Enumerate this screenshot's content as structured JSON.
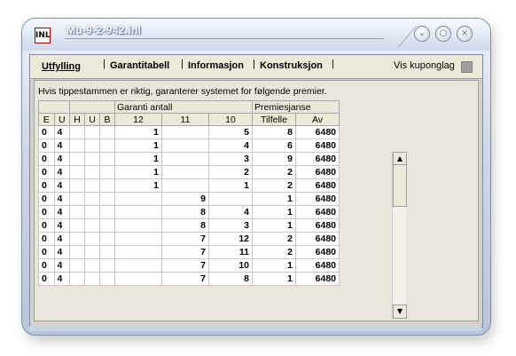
{
  "window": {
    "title": "Mu-9-2-942.inl",
    "icon_label": "INL"
  },
  "tabs": [
    {
      "label": "Utfylling",
      "active": true
    },
    {
      "label": "Garantitabell",
      "active": false
    },
    {
      "label": "Informasjon",
      "active": false
    },
    {
      "label": "Konstruksjon",
      "active": false
    }
  ],
  "separator": "|",
  "vis_kuponglag": {
    "label": "Vis kuponglag",
    "checked": false
  },
  "info_text": "Hvis tippestammen er riktig, garanterer systemet for følgende premier.",
  "table": {
    "group_headers": [
      "",
      "Garanti antall",
      "Premiesjanse"
    ],
    "columns": [
      "E",
      "U",
      "H",
      "U",
      "B",
      "12",
      "11",
      "10",
      "Tilfelle",
      "Av"
    ],
    "rows": [
      [
        "0",
        "4",
        "",
        "",
        "",
        "1",
        "",
        "5",
        "8",
        "6480"
      ],
      [
        "0",
        "4",
        "",
        "",
        "",
        "1",
        "",
        "4",
        "6",
        "6480"
      ],
      [
        "0",
        "4",
        "",
        "",
        "",
        "1",
        "",
        "3",
        "9",
        "6480"
      ],
      [
        "0",
        "4",
        "",
        "",
        "",
        "1",
        "",
        "2",
        "2",
        "6480"
      ],
      [
        "0",
        "4",
        "",
        "",
        "",
        "1",
        "",
        "1",
        "2",
        "6480"
      ],
      [
        "0",
        "4",
        "",
        "",
        "",
        "",
        "9",
        "",
        "1",
        "6480"
      ],
      [
        "0",
        "4",
        "",
        "",
        "",
        "",
        "8",
        "4",
        "1",
        "6480"
      ],
      [
        "0",
        "4",
        "",
        "",
        "",
        "",
        "8",
        "3",
        "1",
        "6480"
      ],
      [
        "0",
        "4",
        "",
        "",
        "",
        "",
        "7",
        "12",
        "2",
        "6480"
      ],
      [
        "0",
        "4",
        "",
        "",
        "",
        "",
        "7",
        "11",
        "2",
        "6480"
      ],
      [
        "0",
        "4",
        "",
        "",
        "",
        "",
        "7",
        "10",
        "1",
        "6480"
      ],
      [
        "0",
        "4",
        "",
        "",
        "",
        "",
        "7",
        "8",
        "1",
        "6480"
      ]
    ]
  },
  "icons": {
    "minimize": "minimize-icon",
    "maximize": "maximize-icon",
    "close": "close-icon",
    "scroll_up": "scroll-up-arrow-icon",
    "scroll_down": "scroll-down-arrow-icon"
  }
}
